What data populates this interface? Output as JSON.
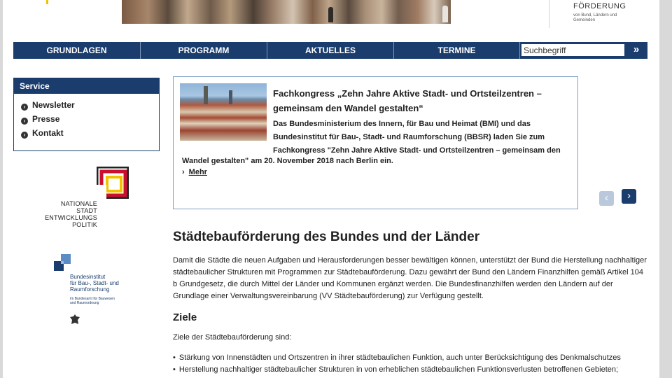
{
  "header": {
    "logo_right_line1": "FÖRDERUNG",
    "logo_right_line2": "von Bund, Ländern und Gemeinden"
  },
  "nav": {
    "items": [
      "GRUNDLAGEN",
      "PROGRAMM",
      "AKTUELLES",
      "TERMINE"
    ],
    "search_value": "Suchbegriff",
    "search_button": "»"
  },
  "service": {
    "title": "Service",
    "items": [
      "Newsletter",
      "Presse",
      "Kontakt"
    ]
  },
  "logos": {
    "nsp_text": "NATIONALE\nSTADT\nENTWICKLUNGS\nPOLITIK",
    "bbsr_text": "Bundesinstitut\nfür Bau-, Stadt- und\nRaumforschung",
    "bbsr_sub": "im Bundesamt für Bauwesen\nund Raumordnung"
  },
  "news": {
    "title": "Fachkongress „Zehn Jahre Aktive Stadt- und Ortsteilzentren – gemeinsam den Wandel gestalten“",
    "body_part1": "Das Bundesministerium des Innern, für Bau und Heimat (BMI) und das Bundesinstitut für Bau-, Stadt- und Raumforschung (BBSR) laden Sie zum Fachkongress \"Zehn Jahre Aktive Stadt- und Ortsteilzentren – gemeinsam den",
    "body_part2": "Wandel gestalten\" am 20. November 2018 nach Berlin ein.",
    "more": "Mehr",
    "prev": "‹",
    "next": "›"
  },
  "main": {
    "heading": "Städtebauförderung des Bundes und der Länder",
    "intro": "Damit die Städte die neuen Aufgaben und Herausforderungen besser bewältigen können, unterstützt der Bund die Herstellung nachhaltiger städtebaulicher Strukturen mit Programmen zur Städtebauförderung. Dazu gewährt der Bund den Ländern Finanzhilfen gemäß Artikel 104 b Grundgesetz, die durch Mittel der Länder und Kommunen ergänzt werden. Die Bundesfinanzhilfen werden den Ländern auf der Grundlage einer Verwaltungsvereinbarung (VV Städtebauförderung) zur Verfügung gestellt.",
    "goals_heading": "Ziele",
    "goals_intro": "Ziele der Städtebauförderung sind:",
    "goals": [
      "Stärkung von Innenstädten und Ortszentren in ihrer städtebaulichen Funktion, auch unter Berücksichtigung des Denkmalschutzes",
      "Herstellung nachhaltiger städtebaulicher Strukturen in von erheblichen städtebaulichen Funktionsverlusten betroffenen Gebieten;"
    ]
  },
  "colors": {
    "brand_blue": "#1a3d6e",
    "accent_yellow": "#f2c200",
    "nsp_red": "#c8102e"
  }
}
